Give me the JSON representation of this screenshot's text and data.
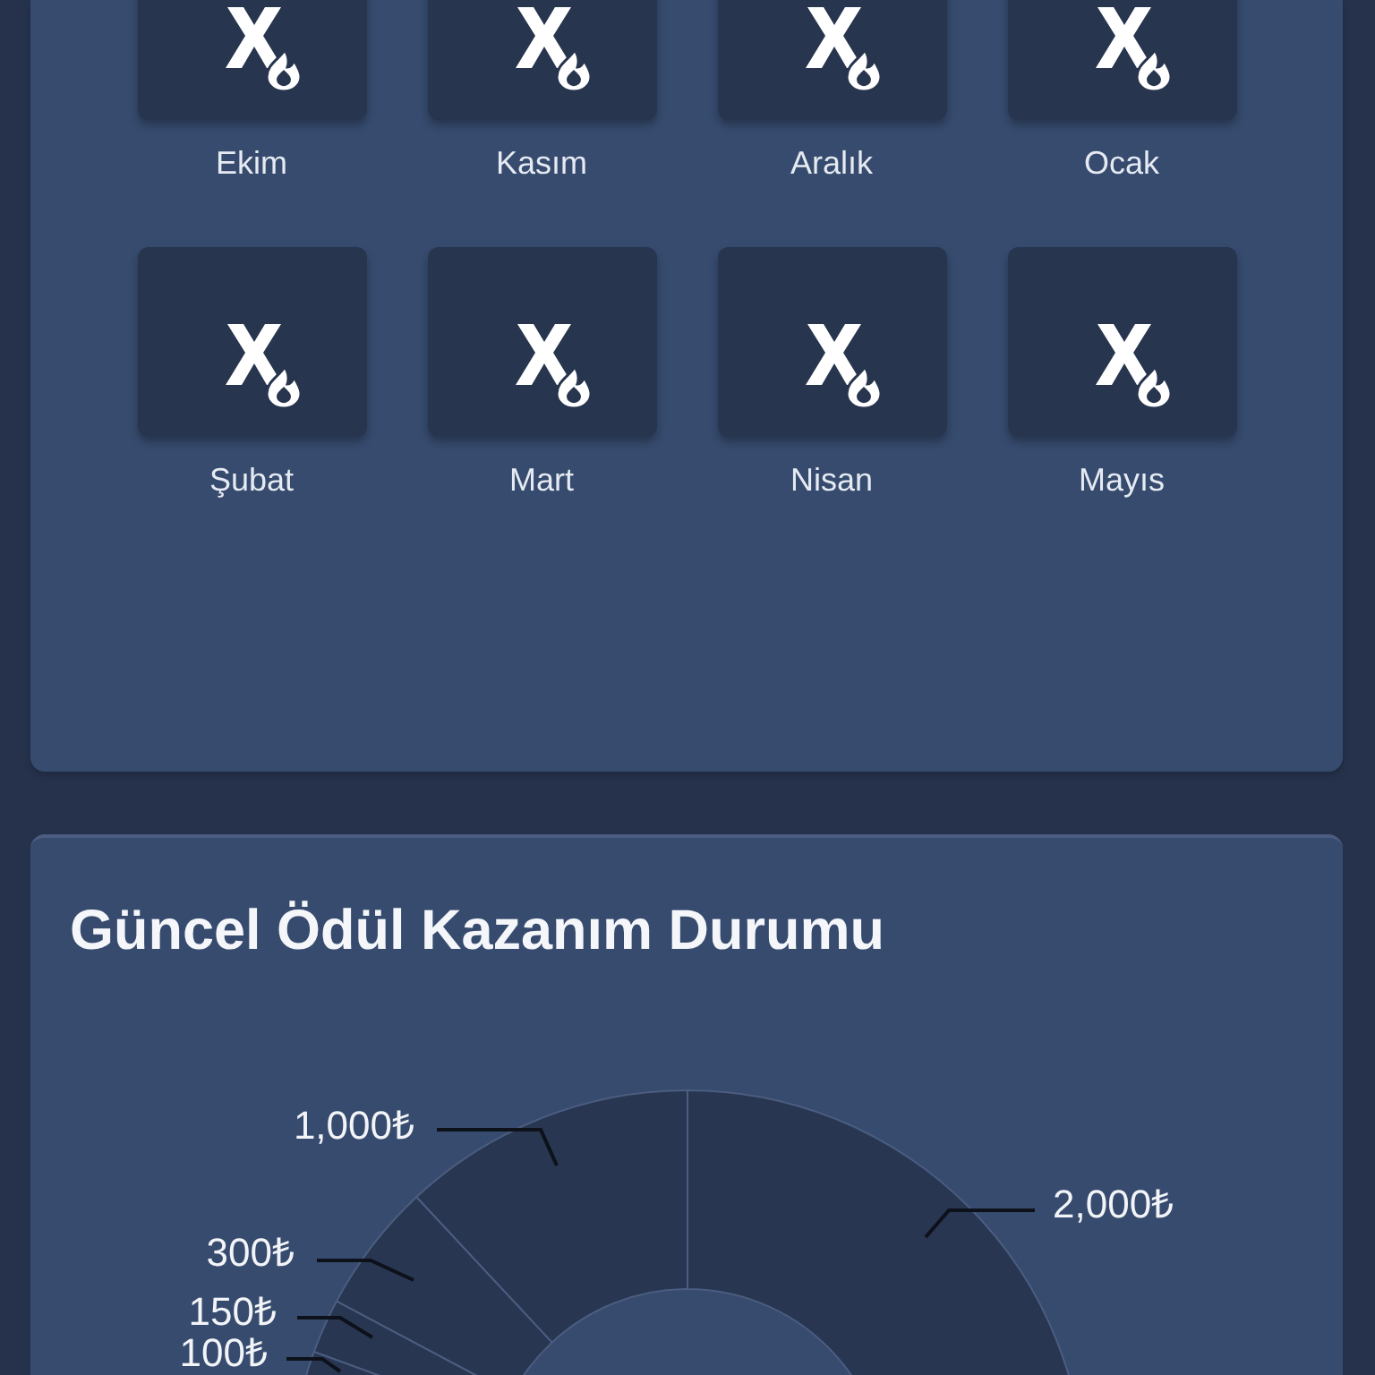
{
  "month_grid": {
    "months": [
      "Ekim",
      "Kasım",
      "Aralık",
      "Ocak",
      "Şubat",
      "Mart",
      "Nisan",
      "Mayıs"
    ]
  },
  "reward_status": {
    "title": "Güncel Ödül Kazanım Durumu",
    "donut_labels": [
      "2,000₺",
      "1,000₺",
      "300₺",
      "150₺",
      "100₺"
    ]
  }
}
